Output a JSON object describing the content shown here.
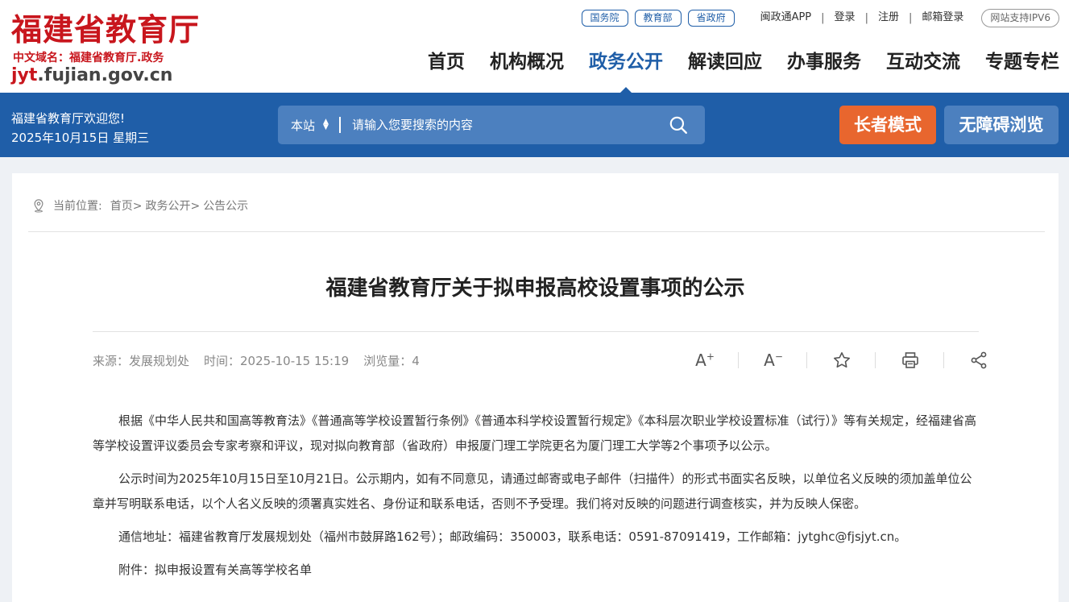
{
  "header": {
    "logo_title": "福建省教育厅",
    "logo_domain": "中文域名：福建省教育厅.政务",
    "logo_url_prefix": "jyt",
    "logo_url_suffix": ".fujian.gov.cn",
    "pills": [
      "国务院",
      "教育部",
      "省政府"
    ],
    "links": [
      "闽政通APP",
      "登录",
      "注册",
      "邮箱登录"
    ],
    "ipv6_label": "网站支持IPV6",
    "nav": [
      "首页",
      "机构概况",
      "政务公开",
      "解读回应",
      "办事服务",
      "互动交流",
      "专题专栏"
    ],
    "nav_active_index": 2
  },
  "band": {
    "welcome_line1": "福建省教育厅欢迎您!",
    "welcome_line2": "2025年10月15日 星期三",
    "search_scope": "本站",
    "search_placeholder": "请输入您要搜索的内容",
    "elder_mode_label": "长者模式",
    "accessible_label": "无障碍浏览"
  },
  "breadcrumb": {
    "prefix": "当前位置:",
    "items": [
      "首页>",
      "政务公开>",
      "公告公示"
    ]
  },
  "article": {
    "title": "福建省教育厅关于拟申报高校设置事项的公示",
    "source": "来源：发展规划处",
    "time": "时间：2025-10-15 15:19",
    "views": "浏览量：4",
    "paragraphs": [
      "根据《中华人民共和国高等教育法》《普通高等学校设置暂行条例》《普通本科学校设置暂行规定》《本科层次职业学校设置标准（试行）》等有关规定，经福建省高等学校设置评议委员会专家考察和评议，现对拟向教育部（省政府）申报厦门理工学院更名为厦门理工大学等2个事项予以公示。",
      "公示时间为2025年10月15日至10月21日。公示期内，如有不同意见，请通过邮寄或电子邮件（扫描件）的形式书面实名反映，以单位名义反映的须加盖单位公章并写明联系电话，以个人名义反映的须署真实姓名、身份证和联系电话，否则不予受理。我们将对反映的问题进行调查核实，并为反映人保密。",
      "通信地址：福建省教育厅发展规划处（福州市鼓屏路162号）；邮政编码：350003，联系电话：0591-87091419，工作邮箱：jytghc@fjsjyt.cn。",
      "附件：拟申报设置有关高等学校名单"
    ]
  },
  "colors": {
    "brand_red": "#c8161d",
    "brand_blue": "#1f5ea8",
    "elder_orange": "#e8662e"
  }
}
